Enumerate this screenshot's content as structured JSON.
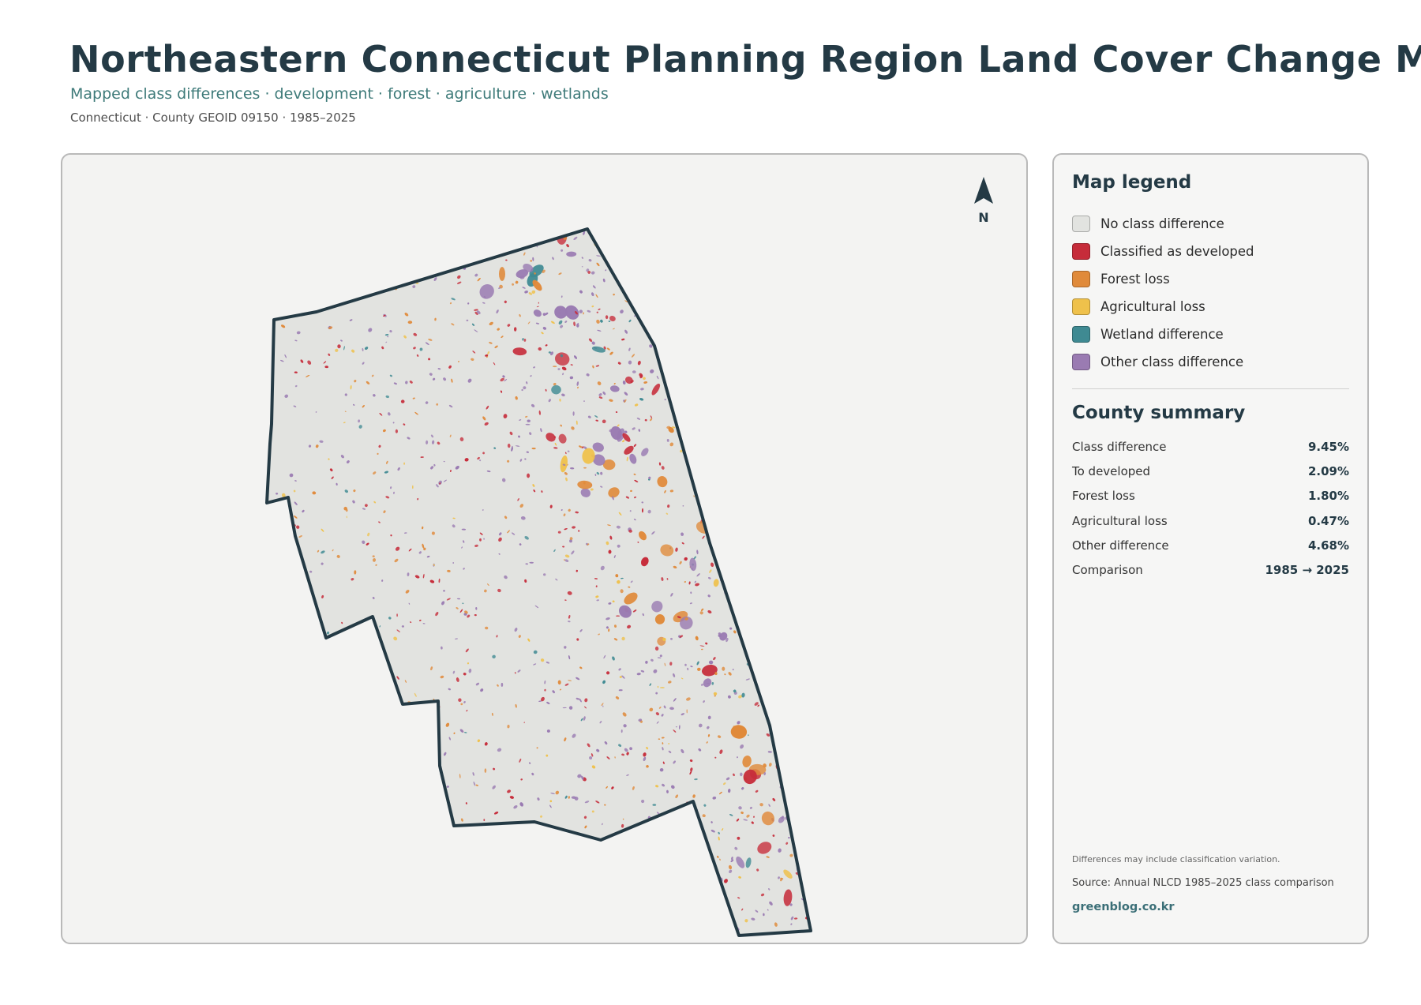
{
  "header": {
    "title": "Northeastern Connecticut Planning Region Land Cover Change Map",
    "subtitle": "Mapped class differences · development · forest · agriculture · wetlands",
    "meta": "Connecticut · County GEOID 09150 · 1985–2025"
  },
  "map": {
    "north_label": "N",
    "colors": {
      "background": "#f3f3f2",
      "county_fill": "#e2e3e0",
      "boundary": "#243a45",
      "developed": "#c62c3a",
      "forest_loss": "#e08a3a",
      "agricultural_loss": "#efc14b",
      "wetland": "#3f8a92",
      "other": "#9a7bb2"
    }
  },
  "legend": {
    "title": "Map legend",
    "items": [
      {
        "label": "No class difference",
        "color": "#e2e3e0"
      },
      {
        "label": "Classified as developed",
        "color": "#c62c3a"
      },
      {
        "label": "Forest loss",
        "color": "#e08a3a"
      },
      {
        "label": "Agricultural loss",
        "color": "#efc14b"
      },
      {
        "label": "Wetland difference",
        "color": "#3f8a92"
      },
      {
        "label": "Other class difference",
        "color": "#9a7bb2"
      }
    ]
  },
  "summary": {
    "title": "County summary",
    "rows": [
      {
        "label": "Class difference",
        "value": "9.45%"
      },
      {
        "label": "To developed",
        "value": "2.09%"
      },
      {
        "label": "Forest loss",
        "value": "1.80%"
      },
      {
        "label": "Agricultural loss",
        "value": "0.47%"
      },
      {
        "label": "Other difference",
        "value": "4.68%"
      },
      {
        "label": "Comparison",
        "value": "1985 → 2025"
      }
    ]
  },
  "footer": {
    "note": "Differences may include classification variation.",
    "source": "Source: Annual NLCD 1985–2025 class comparison",
    "site": "greenblog.co.kr"
  }
}
